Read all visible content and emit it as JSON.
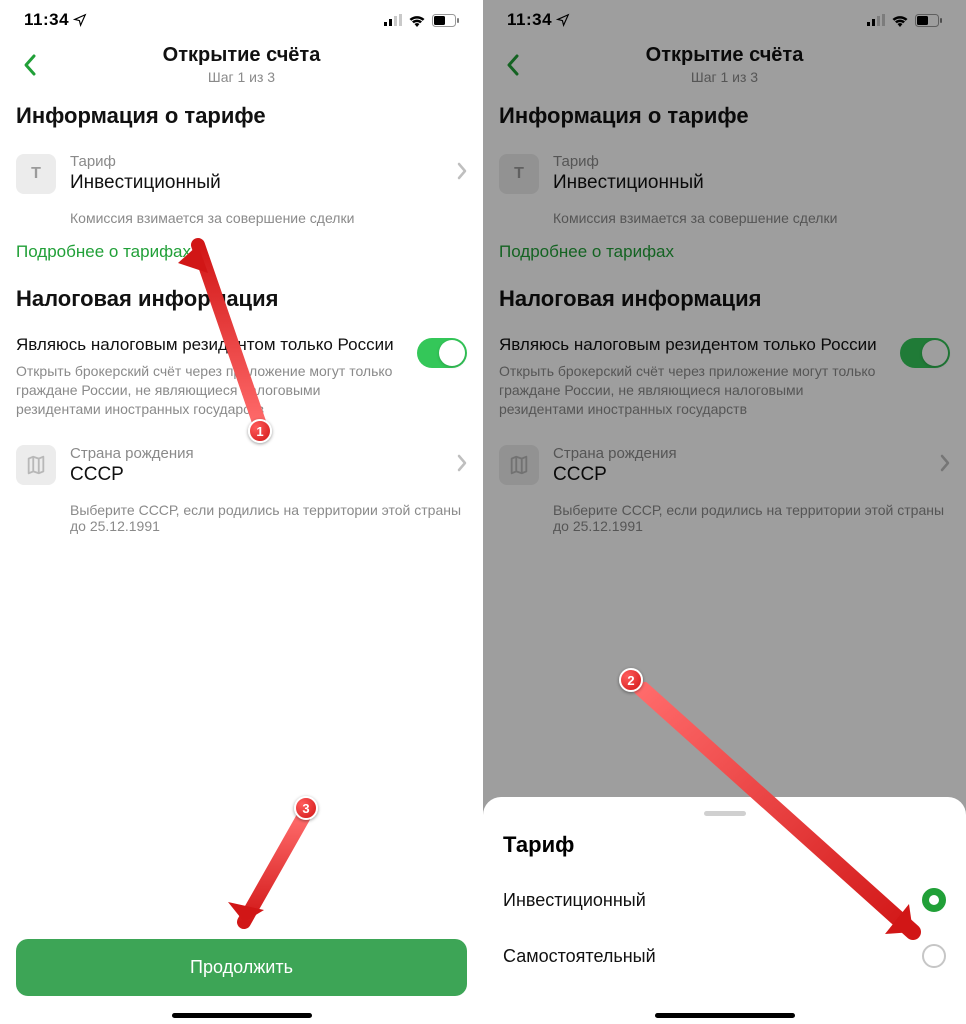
{
  "statusbar": {
    "time": "11:34"
  },
  "header": {
    "title": "Открытие счёта",
    "subtitle": "Шаг 1 из 3"
  },
  "tariff_section": {
    "title": "Информация о тарифе",
    "row_label": "Тариф",
    "row_value": "Инвестиционный",
    "row_icon_glyph": "T",
    "note": "Комиссия взимается за совершение сделки",
    "more_link": "Подробнее о тарифах"
  },
  "tax_section": {
    "title": "Налоговая информация",
    "toggle_title": "Являюсь налоговым резидентом только России",
    "toggle_desc": "Открыть брокерский счёт через приложение могут только граждане России, не являющиеся налоговыми резидентами иностранных государств",
    "toggle_on": true,
    "birth_label": "Страна рождения",
    "birth_value": "СССР",
    "birth_note": "Выберите СССР, если родились на территории этой страны до 25.12.1991"
  },
  "continue_button": "Продолжить",
  "sheet": {
    "title": "Тариф",
    "options": [
      {
        "label": "Инвестиционный",
        "selected": true
      },
      {
        "label": "Самостоятельный",
        "selected": false
      }
    ]
  },
  "annotations": {
    "badge1": "1",
    "badge2": "2",
    "badge3": "3"
  }
}
